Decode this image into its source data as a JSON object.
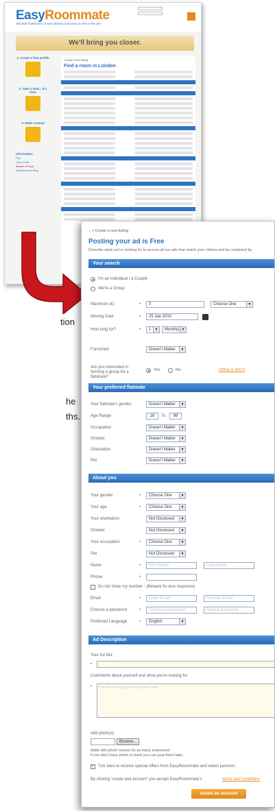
{
  "background_page": {
    "logo_easy": "Easy",
    "logo_room": "Roommate",
    "tagline": "160,000 Flatshares, House Shares & Rooms to rent in the UK!",
    "banner": "We'll bring you closer.",
    "sidebar_steps": [
      "1. Create a free profile",
      "2. Take a look... It's free!",
      "3. Make contact"
    ],
    "sidebar_info": "Information",
    "sidebar_links": [
      "FAQ",
      "Tips & Tricks",
      "Beware of Fraud",
      "EasyRoommate Blog"
    ],
    "crumb": "Create a new listing",
    "title": "Find a room in London"
  },
  "cut_text": {
    "line1": "tion",
    "line2": "he",
    "line3": "ths."
  },
  "form": {
    "breadcrumb_home": "⌂",
    "breadcrumb": "> Create a new listing",
    "title": "Posting your ad is Free",
    "subtitle": "Describe what you're looking for to access all our ads that match your criteria and be contacted by",
    "section_search": "Your search",
    "radio_individual": "I'm an Individual / a Couple",
    "radio_group": "We're a Group",
    "label_maximum": "Maximum (£)",
    "maximum_value": "0",
    "maximum_period": "Choose One",
    "label_moving_date": "Moving Date",
    "moving_date": "25 Jan 2010",
    "label_how_long": "How long for?",
    "how_long_value": "1",
    "how_long_unit": "Month(s)",
    "label_furnished": "Furnished",
    "furnished_value": "Doesn't Matter",
    "label_group_q": "Are you interested in forming a group for a flatshare?",
    "radio_yes": "Yes",
    "radio_no": "No",
    "what_is_this": "(What is this?)",
    "section_flatmate": "Your preferred flatmate",
    "flatmate_fields": [
      {
        "label": "Your flatmate's gender",
        "value": "Doesn't Matter"
      },
      {
        "label": "Age Range",
        "from": "16",
        "to_label": "To",
        "to": "99"
      },
      {
        "label": "Occupation",
        "value": "Doesn't Matter"
      },
      {
        "label": "Smoker",
        "value": "Doesn't Matter"
      },
      {
        "label": "Orientation",
        "value": "Doesn't Matter"
      },
      {
        "label": "Pet",
        "value": "Doesn't Matter"
      }
    ],
    "section_about": "About you",
    "about_fields": [
      {
        "label": "Your gender",
        "value": "Choose One"
      },
      {
        "label": "Your age",
        "value": "Choose One"
      },
      {
        "label": "Your orientation",
        "value": "Not Disclosed"
      },
      {
        "label": "Smoker",
        "value": "Not Disclosed"
      },
      {
        "label": "Your occupation",
        "value": "Choose One"
      },
      {
        "label": "Pet",
        "value": "Not Disclosed"
      }
    ],
    "label_name": "Name",
    "first_name_ph": "First Name",
    "last_name_ph": "Last Name",
    "label_phone": "Phone",
    "hide_number": "Do not show my number - (Beware 5x less response)",
    "label_email": "Email",
    "email_ph": "Enter Email",
    "reemail_ph": "Reenter Email",
    "label_password": "Choose a password",
    "password_ph": "Choose a password",
    "repeat_ph": "Repeat password",
    "label_language": "Preferred Language",
    "language_value": "English",
    "section_ad": "Ad Description",
    "label_ad_title": "Your Ad title",
    "label_comments": "Comments about yourself and what you're looking for",
    "comments_ph": "Please do not type any contact info",
    "label_photos": "Add photo(s)",
    "browse": "Browse...",
    "photo_note1": "Adds with photo receive 5x as many responses!",
    "photo_note2": "If you don't have photo to hand you can post them later.",
    "offers": "Tick here to receive special offers from EasyRoommate and select partners",
    "terms_prefix": "By clicking 'create and account' you accept EasyRoommate's",
    "terms_link": "terms and conditions",
    "create_button": "create an account"
  },
  "colors": {
    "brand_blue": "#2f74c0",
    "brand_orange": "#e48a1c",
    "arrow_red": "#c8161d"
  }
}
